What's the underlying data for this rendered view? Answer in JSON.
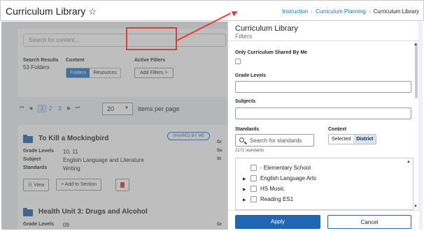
{
  "header": {
    "title": "Curriculum Library",
    "star_icon": "star-outline-icon",
    "breadcrumbs": [
      "Instruction",
      "Curriculum Planning",
      "Curriculum Library"
    ]
  },
  "search": {
    "placeholder": "Search for content...",
    "results_label": "Search Results",
    "results_value": "53 Folders",
    "content_label": "Content",
    "content_options": [
      "Folders",
      "Resources"
    ],
    "content_selected": "Folders",
    "active_filters_label": "Active Filters",
    "add_filters_label": "Add Filters",
    "add_filters_chevron": ">"
  },
  "pager": {
    "first": "⏮",
    "prev": "◀",
    "pages": [
      "1",
      "2",
      "3"
    ],
    "current_page": "1",
    "next": "▶",
    "last": "⏭",
    "per_page": "20",
    "per_page_label": "items per page"
  },
  "cards": [
    {
      "title": "To Kill a Mockingbird",
      "badge": "SHARED BY ME",
      "grade_label": "Grade Levels",
      "grade_value": "10, 11",
      "subject_label": "Subject",
      "subject_value": "English Language and Literature",
      "standards_label": "Standards",
      "standards_value": "Writing",
      "view_label": "View",
      "add_label": "Add to Section"
    },
    {
      "title": "Health Unit 3: Drugs and Alcohol",
      "grade_label": "Grade Levels",
      "grade_value": "09"
    }
  ],
  "side_peek": {
    "labels": [
      "Gr",
      "Su",
      "St",
      "Gr"
    ]
  },
  "panel": {
    "title": "Curriculum Library",
    "subtitle": "Filters",
    "shared_label": "Only Curriculum Shared By Me",
    "grade_levels_label": "Grade Levels",
    "subjects_label": "Subjects",
    "standards_label": "Standards",
    "context_label": "Context",
    "standards_placeholder": "Search for standards",
    "standards_count": "2172 standards",
    "context_options": [
      "Selected",
      "District"
    ],
    "context_selected": "District",
    "tree_items": [
      {
        "label": "- Elementary School",
        "expandable": false
      },
      {
        "label": "English Language Arts",
        "expandable": true
      },
      {
        "label": "HS Music",
        "expandable": true
      },
      {
        "label": "Reading ES1",
        "expandable": true
      }
    ],
    "apply_label": "Apply",
    "cancel_label": "Cancel"
  },
  "colors": {
    "accent": "#1f66b5",
    "highlight": "#e23c3c"
  }
}
